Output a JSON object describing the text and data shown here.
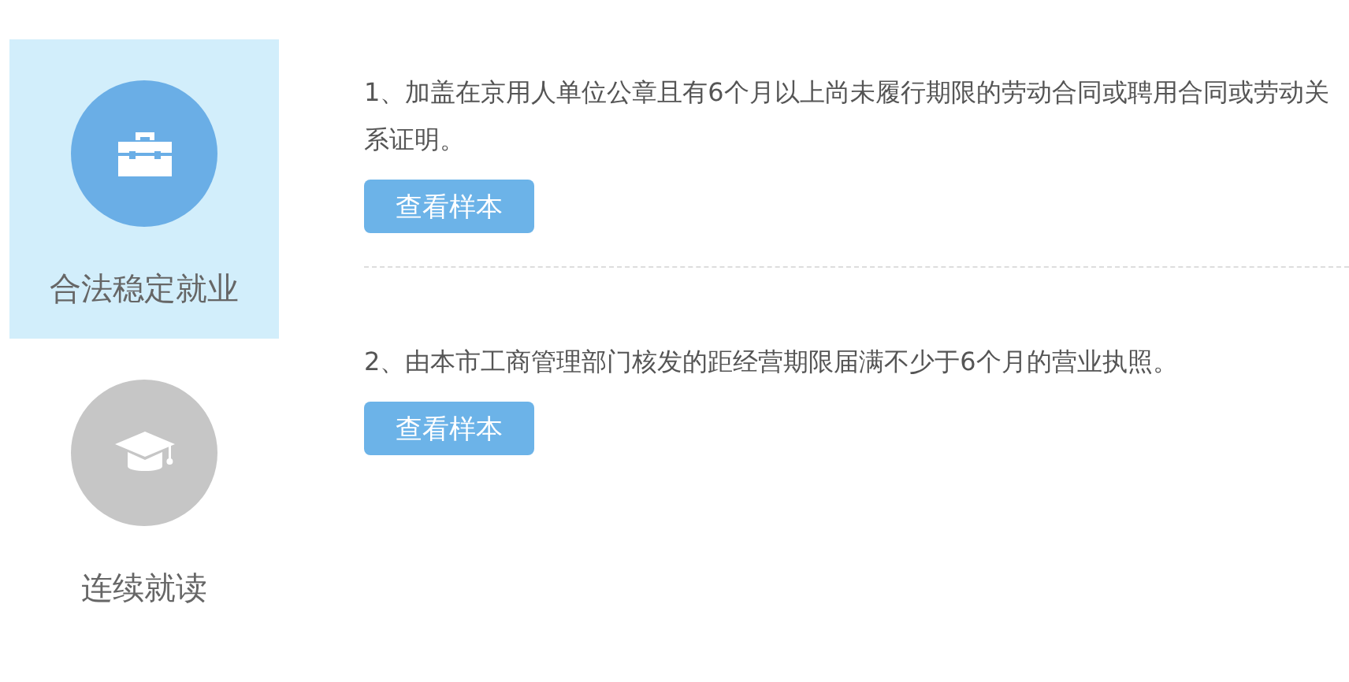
{
  "categories": [
    {
      "label": "合法稳定就业",
      "kind": "briefcase",
      "selected": true
    },
    {
      "label": "连续就读",
      "kind": "graduation",
      "selected": false
    }
  ],
  "requirements": [
    {
      "text": "1、加盖在京用人单位公章且有6个月以上尚未履行期限的劳动合同或聘用合同或劳动关系证明。",
      "button": "查看样本"
    },
    {
      "text": "2、由本市工商管理部门核发的距经营期限届满不少于6个月的营业执照。",
      "button": "查看样本"
    }
  ]
}
